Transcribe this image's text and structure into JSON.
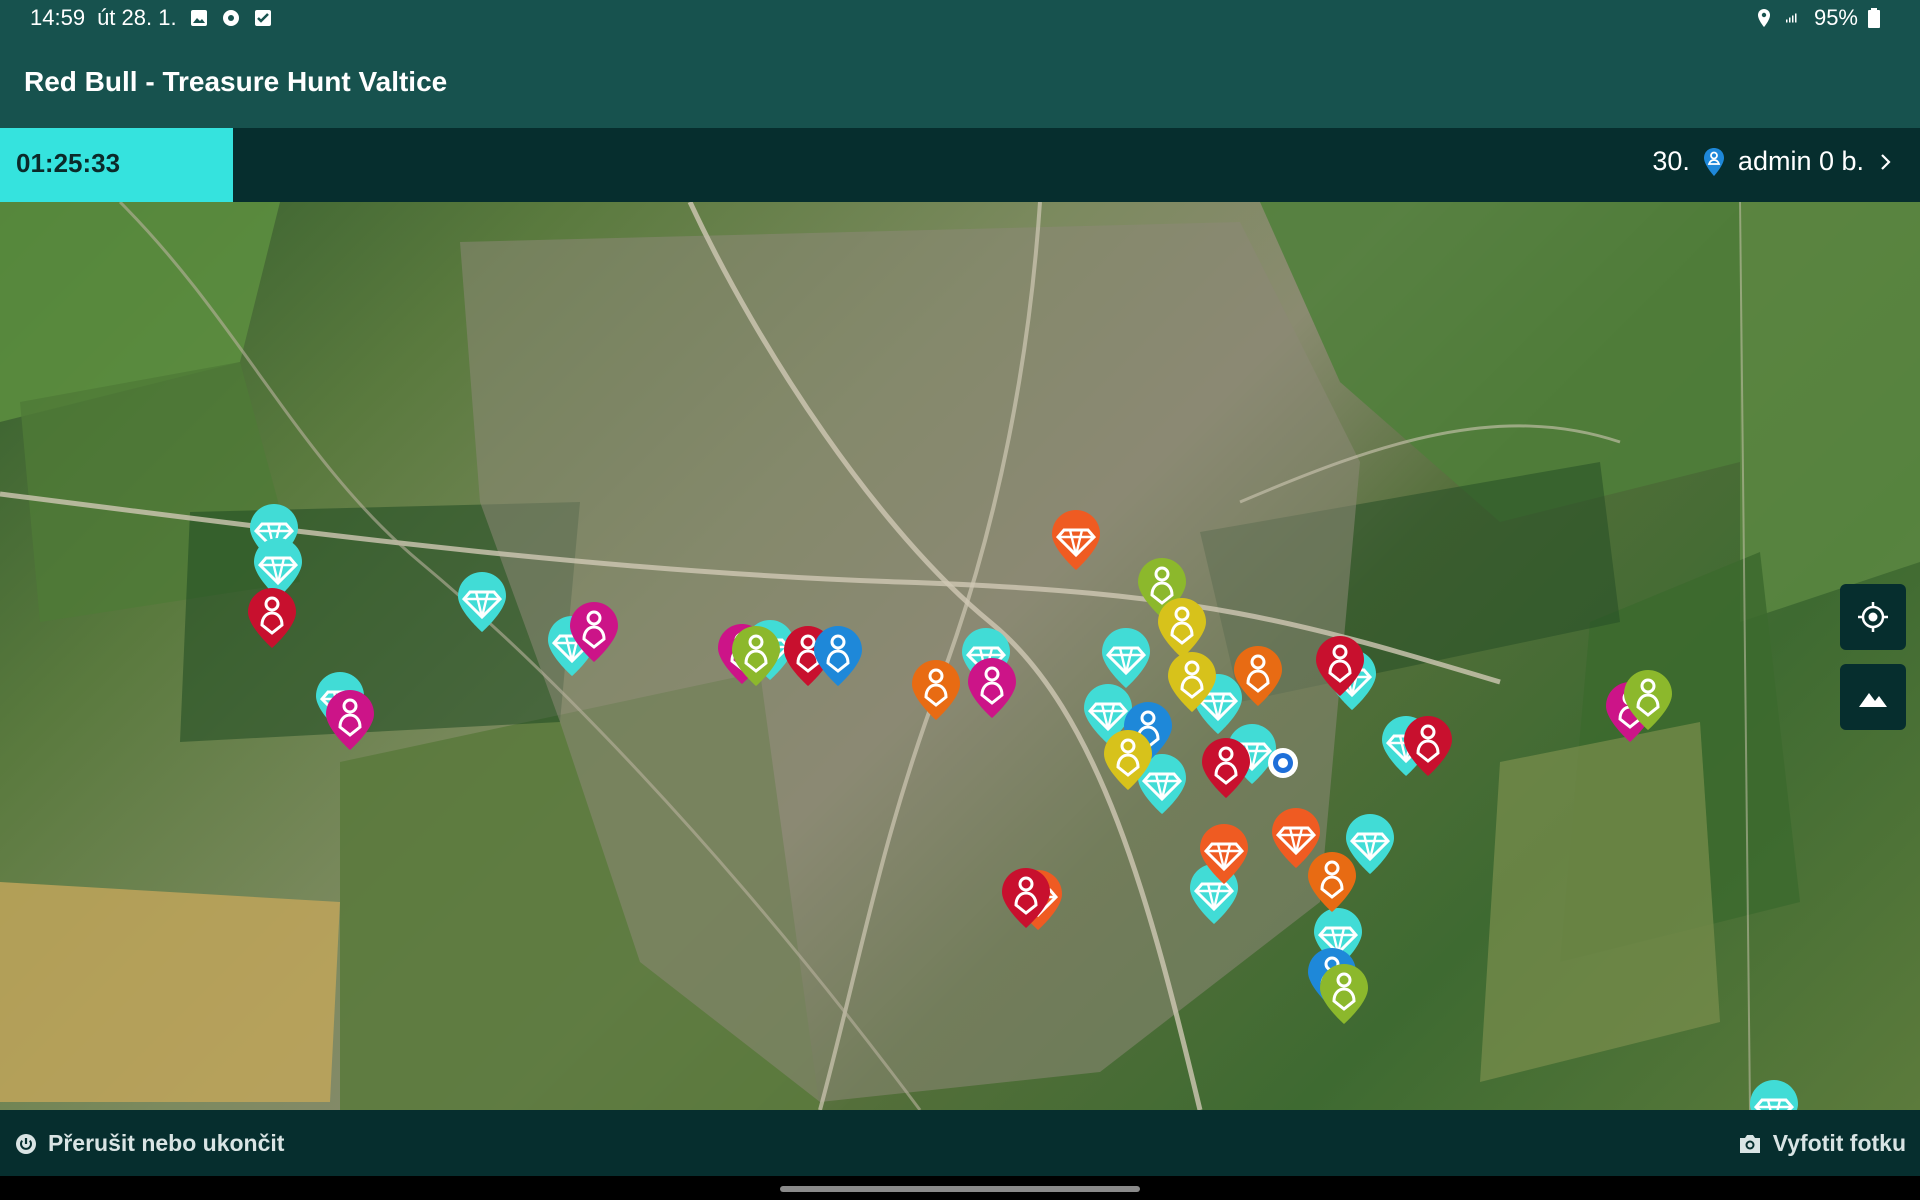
{
  "status_bar": {
    "time": "14:59",
    "date": "út 28. 1.",
    "left_icons": [
      "gallery-icon",
      "app-icon",
      "checkbox-icon"
    ],
    "right_icons": [
      "location-icon",
      "signal-icon"
    ],
    "battery": "95%"
  },
  "app_bar": {
    "title": "Red Bull - Treasure Hunt Valtice"
  },
  "info_bar": {
    "timer": "01:25:33",
    "rank": "30.",
    "user": "admin 0 b."
  },
  "map": {
    "markers": {
      "types": [
        "treasure",
        "player"
      ],
      "colors": {
        "cyan": "#41dcd6",
        "orange": "#ef5b22",
        "red": "#c8102e",
        "magenta": "#cc1488",
        "blue": "#1e88d9",
        "green": "#8cb82c",
        "yellow": "#d7c21b",
        "dark_orange": "#e86b13"
      }
    },
    "controls": [
      "my-location-button",
      "map-layers-button"
    ]
  },
  "bottom_bar": {
    "stop_label": "Přerušit nebo ukončit",
    "photo_label": "Vyfotit fotku"
  },
  "colors": {
    "header": "#17524e",
    "dark": "#062e2e",
    "accent": "#35e3de"
  }
}
